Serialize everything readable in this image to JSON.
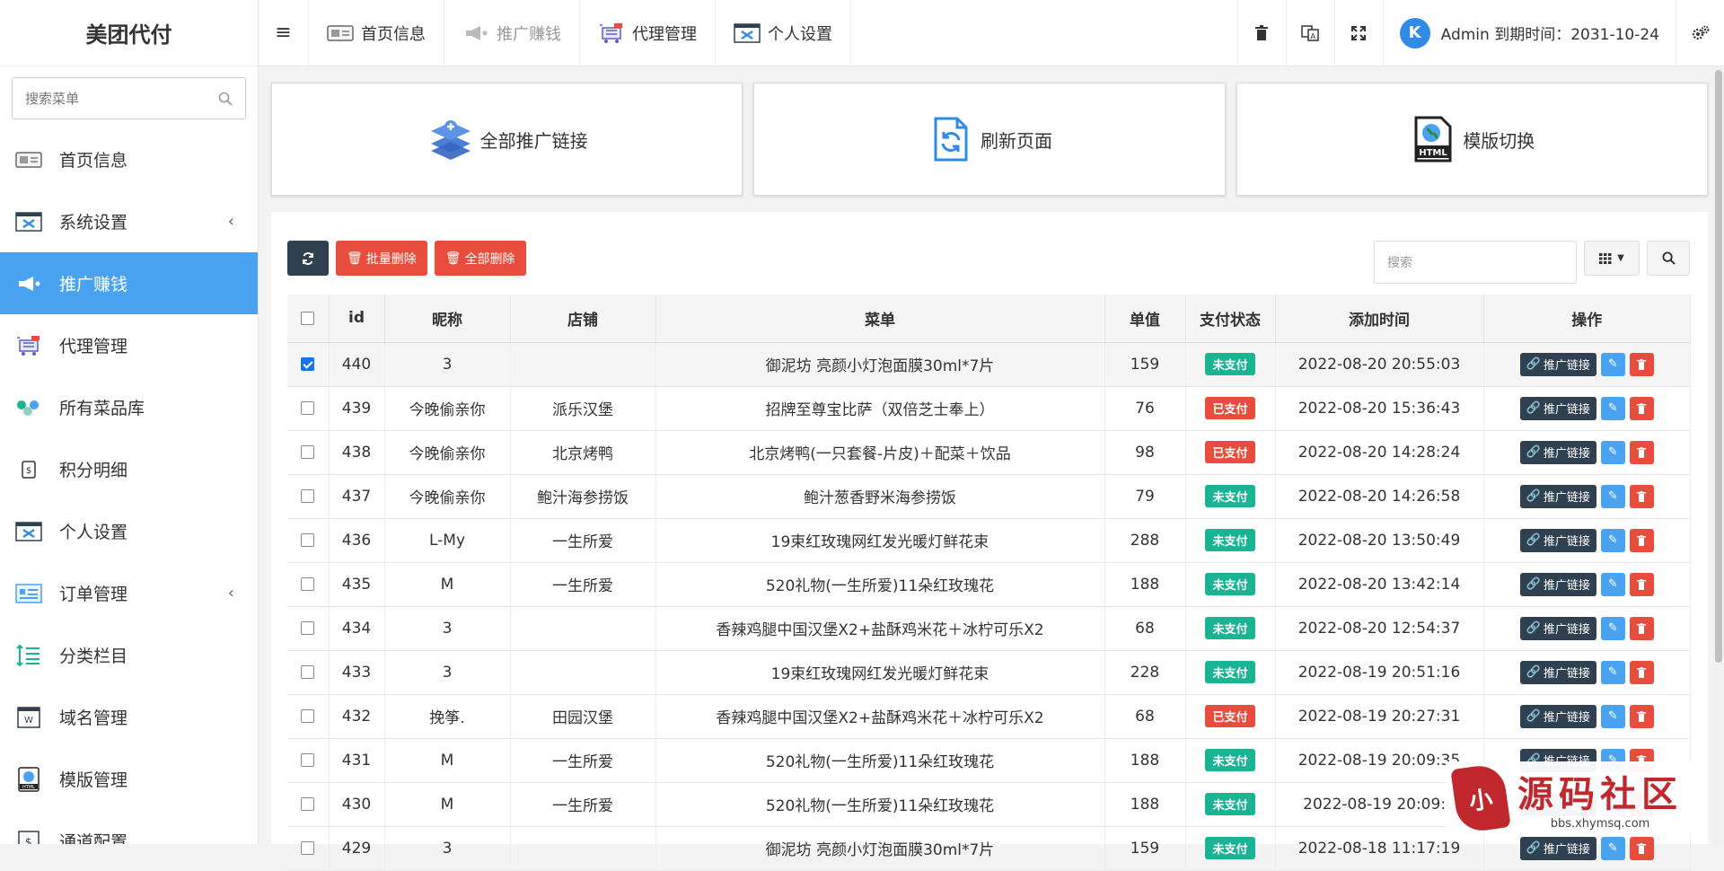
{
  "app": {
    "title": "美团代付"
  },
  "sidebar": {
    "search_placeholder": "搜索菜单",
    "items": [
      {
        "label": "首页信息",
        "icon": "home-screen-icon",
        "has_children": false
      },
      {
        "label": "系统设置",
        "icon": "settings-window-icon",
        "has_children": true
      },
      {
        "label": "推广赚钱",
        "icon": "megaphone-icon",
        "has_children": false,
        "active": true
      },
      {
        "label": "代理管理",
        "icon": "cart-icon",
        "has_children": false
      },
      {
        "label": "所有菜品库",
        "icon": "dishes-icon",
        "has_children": false
      },
      {
        "label": "积分明细",
        "icon": "points-icon",
        "has_children": false
      },
      {
        "label": "个人设置",
        "icon": "profile-window-icon",
        "has_children": false
      },
      {
        "label": "订单管理",
        "icon": "orders-icon",
        "has_children": true
      },
      {
        "label": "分类栏目",
        "icon": "category-list-icon",
        "has_children": false
      },
      {
        "label": "域名管理",
        "icon": "domain-icon",
        "has_children": false
      },
      {
        "label": "模版管理",
        "icon": "html-template-icon",
        "has_children": false
      },
      {
        "label": "通道配置",
        "icon": "channel-icon",
        "has_children": false
      }
    ]
  },
  "topbar": {
    "tabs": [
      {
        "label": "首页信息",
        "dim": false
      },
      {
        "label": "推广赚钱",
        "dim": true
      },
      {
        "label": "代理管理",
        "dim": false
      },
      {
        "label": "个人设置",
        "dim": false
      }
    ],
    "user_text": "Admin 到期时间：2031-10-24",
    "avatar_letter": "K"
  },
  "cards": [
    {
      "label": "全部推广链接",
      "icon": "layers-add-icon"
    },
    {
      "label": "刷新页面",
      "icon": "refresh-document-icon"
    },
    {
      "label": "模版切换",
      "icon": "html-globe-icon"
    }
  ],
  "toolbar": {
    "batch_delete": "批量删除",
    "delete_all": "全部删除",
    "search_placeholder": "搜索"
  },
  "table": {
    "headers": [
      "id",
      "昵称",
      "店铺",
      "菜单",
      "单值",
      "支付状态",
      "添加时间",
      "操作"
    ],
    "op_link_label": "推广链接",
    "rows": [
      {
        "checked": true,
        "id": "440",
        "nick": "3",
        "shop": "",
        "menu": "御泥坊 亮颜小灯泡面膜30ml*7片",
        "price": "159",
        "status": "未支付",
        "paid": false,
        "time": "2022-08-20 20:55:03"
      },
      {
        "checked": false,
        "id": "439",
        "nick": "今晚偷亲你",
        "shop": "派乐汉堡",
        "menu": "招牌至尊宝比萨（双倍芝士奉上）",
        "price": "76",
        "status": "已支付",
        "paid": true,
        "time": "2022-08-20 15:36:43"
      },
      {
        "checked": false,
        "id": "438",
        "nick": "今晚偷亲你",
        "shop": "北京烤鸭",
        "menu": "北京烤鸭(一只套餐-片皮)＋配菜＋饮品",
        "price": "98",
        "status": "已支付",
        "paid": true,
        "time": "2022-08-20 14:28:24"
      },
      {
        "checked": false,
        "id": "437",
        "nick": "今晚偷亲你",
        "shop": "鲍汁海参捞饭",
        "menu": "鲍汁葱香野米海参捞饭",
        "price": "79",
        "status": "未支付",
        "paid": false,
        "time": "2022-08-20 14:26:58"
      },
      {
        "checked": false,
        "id": "436",
        "nick": "L-My",
        "shop": "一生所爱",
        "menu": "19束红玫瑰网红发光暖灯鲜花束",
        "price": "288",
        "status": "未支付",
        "paid": false,
        "time": "2022-08-20 13:50:49"
      },
      {
        "checked": false,
        "id": "435",
        "nick": "M",
        "shop": "一生所爱",
        "menu": "520礼物(一生所爱)11朵红玫瑰花",
        "price": "188",
        "status": "未支付",
        "paid": false,
        "time": "2022-08-20 13:42:14"
      },
      {
        "checked": false,
        "id": "434",
        "nick": "3",
        "shop": "",
        "menu": "香辣鸡腿中国汉堡X2+盐酥鸡米花＋冰柠可乐X2",
        "price": "68",
        "status": "未支付",
        "paid": false,
        "time": "2022-08-20 12:54:37"
      },
      {
        "checked": false,
        "id": "433",
        "nick": "3",
        "shop": "",
        "menu": "19束红玫瑰网红发光暖灯鲜花束",
        "price": "228",
        "status": "未支付",
        "paid": false,
        "time": "2022-08-19 20:51:16"
      },
      {
        "checked": false,
        "id": "432",
        "nick": "挽筝.",
        "shop": "田园汉堡",
        "menu": "香辣鸡腿中国汉堡X2+盐酥鸡米花＋冰柠可乐X2",
        "price": "68",
        "status": "已支付",
        "paid": true,
        "time": "2022-08-19 20:27:31"
      },
      {
        "checked": false,
        "id": "431",
        "nick": "M",
        "shop": "一生所爱",
        "menu": "520礼物(一生所爱)11朵红玫瑰花",
        "price": "188",
        "status": "未支付",
        "paid": false,
        "time": "2022-08-19 20:09:35"
      },
      {
        "checked": false,
        "id": "430",
        "nick": "M",
        "shop": "一生所爱",
        "menu": "520礼物(一生所爱)11朵红玫瑰花",
        "price": "188",
        "status": "未支付",
        "paid": false,
        "time": "2022-08-19 20:09:0"
      },
      {
        "checked": false,
        "id": "429",
        "nick": "3",
        "shop": "",
        "menu": "御泥坊 亮颜小灯泡面膜30ml*7片",
        "price": "159",
        "status": "未支付",
        "paid": false,
        "time": "2022-08-18 11:17:19"
      }
    ]
  },
  "watermark": {
    "seal": "小",
    "title": "源码社区",
    "url": "bbs.xhymsq.com"
  },
  "colors": {
    "accent": "#4aa3f0",
    "dark": "#2f4050",
    "danger": "#e74c3c",
    "success": "#1ab394"
  }
}
